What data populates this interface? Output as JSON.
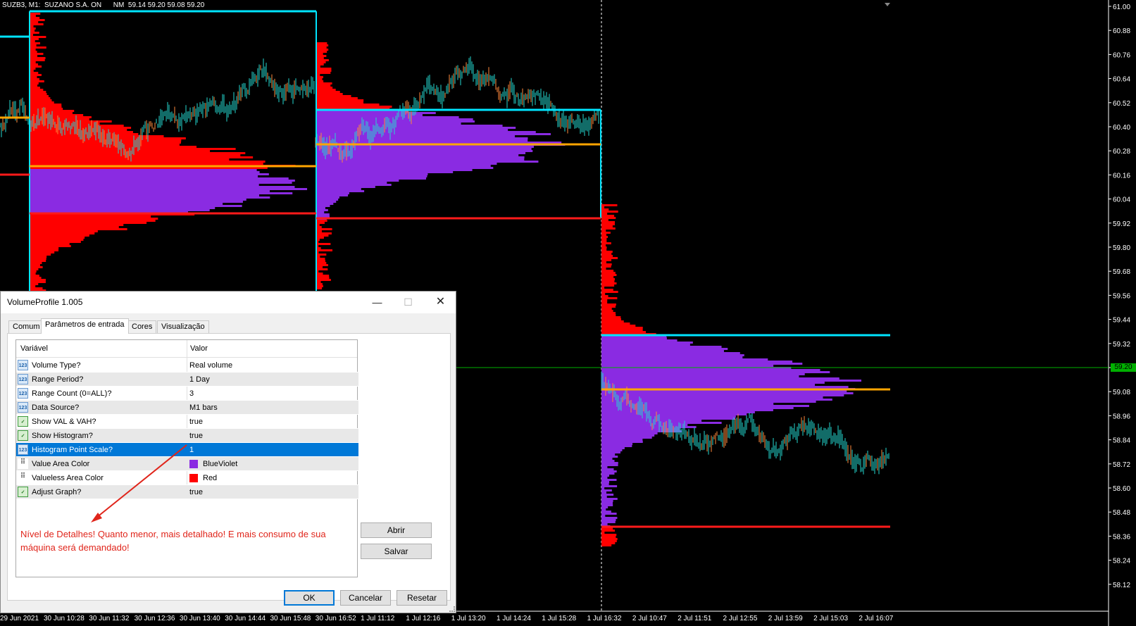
{
  "chart": {
    "header_text": "SUZB3, M1:  SUZANO S.A. ON      NM  59.14 59.20 59.08 59.20",
    "current_price": "59.20",
    "price_labels": [
      "61.00",
      "60.88",
      "60.76",
      "60.64",
      "60.52",
      "60.40",
      "60.28",
      "60.16",
      "60.04",
      "59.92",
      "59.80",
      "59.68",
      "59.56",
      "59.44",
      "59.32",
      "59.20",
      "59.08",
      "58.96",
      "58.84",
      "58.72",
      "58.60",
      "58.48",
      "58.36",
      "58.24",
      "58.12"
    ],
    "time_labels": [
      "29 Jun 2021",
      "30 Jun 10:28",
      "30 Jun 11:32",
      "30 Jun 12:36",
      "30 Jun 13:40",
      "30 Jun 14:44",
      "30 Jun 15:48",
      "30 Jun 16:52",
      "1 Jul 11:12",
      "1 Jul 12:16",
      "1 Jul 13:20",
      "1 Jul 14:24",
      "1 Jul 15:28",
      "1 Jul 16:32",
      "2 Jul 10:47",
      "2 Jul 11:51",
      "2 Jul 12:55",
      "2 Jul 13:59",
      "2 Jul 15:03",
      "2 Jul 16:07"
    ],
    "colors": {
      "value_area": "#8a2be2",
      "valueless_area": "#ff0000",
      "vah_line": "#00e5ff",
      "poc_line": "#ffa500",
      "val_line": "#ff1a1a",
      "candles": "#25d7d0",
      "current_price_line": "#00b000"
    }
  },
  "dialog": {
    "title": "VolumeProfile 1.005",
    "tabs": [
      "Comum",
      "Parâmetros de entrada",
      "Cores",
      "Visualização"
    ],
    "active_tab": "Parâmetros de entrada",
    "columns": {
      "name": "Variável",
      "value": "Valor"
    },
    "rows": [
      {
        "icon": "123",
        "name": "Volume Type?",
        "value": "Real volume"
      },
      {
        "icon": "123",
        "name": "Range Period?",
        "value": "1 Day"
      },
      {
        "icon": "123",
        "name": "Range Count (0=ALL)?",
        "value": "3"
      },
      {
        "icon": "123",
        "name": "Data Source?",
        "value": "M1 bars"
      },
      {
        "icon": "bool",
        "name": "Show VAL & VAH?",
        "value": "true"
      },
      {
        "icon": "bool",
        "name": "Show Histogram?",
        "value": "true"
      },
      {
        "icon": "123",
        "name": "Histogram Point Scale?",
        "value": "1"
      },
      {
        "icon": "color",
        "name": "Value Area Color",
        "value": "BlueViolet",
        "swatch": "#8a2be2"
      },
      {
        "icon": "color",
        "name": "Valueless Area Color",
        "value": "Red",
        "swatch": "#ff0000"
      },
      {
        "icon": "bool",
        "name": "Adjust Graph?",
        "value": "true"
      }
    ],
    "selected_row": "Histogram Point Scale?",
    "note": "Nível de Detalhes! Quanto menor, mais detalhado! E mais consumo de sua máquina será demandado!",
    "buttons": {
      "open": "Abrir",
      "save": "Salvar",
      "ok": "OK",
      "cancel": "Cancelar",
      "reset": "Resetar"
    }
  }
}
